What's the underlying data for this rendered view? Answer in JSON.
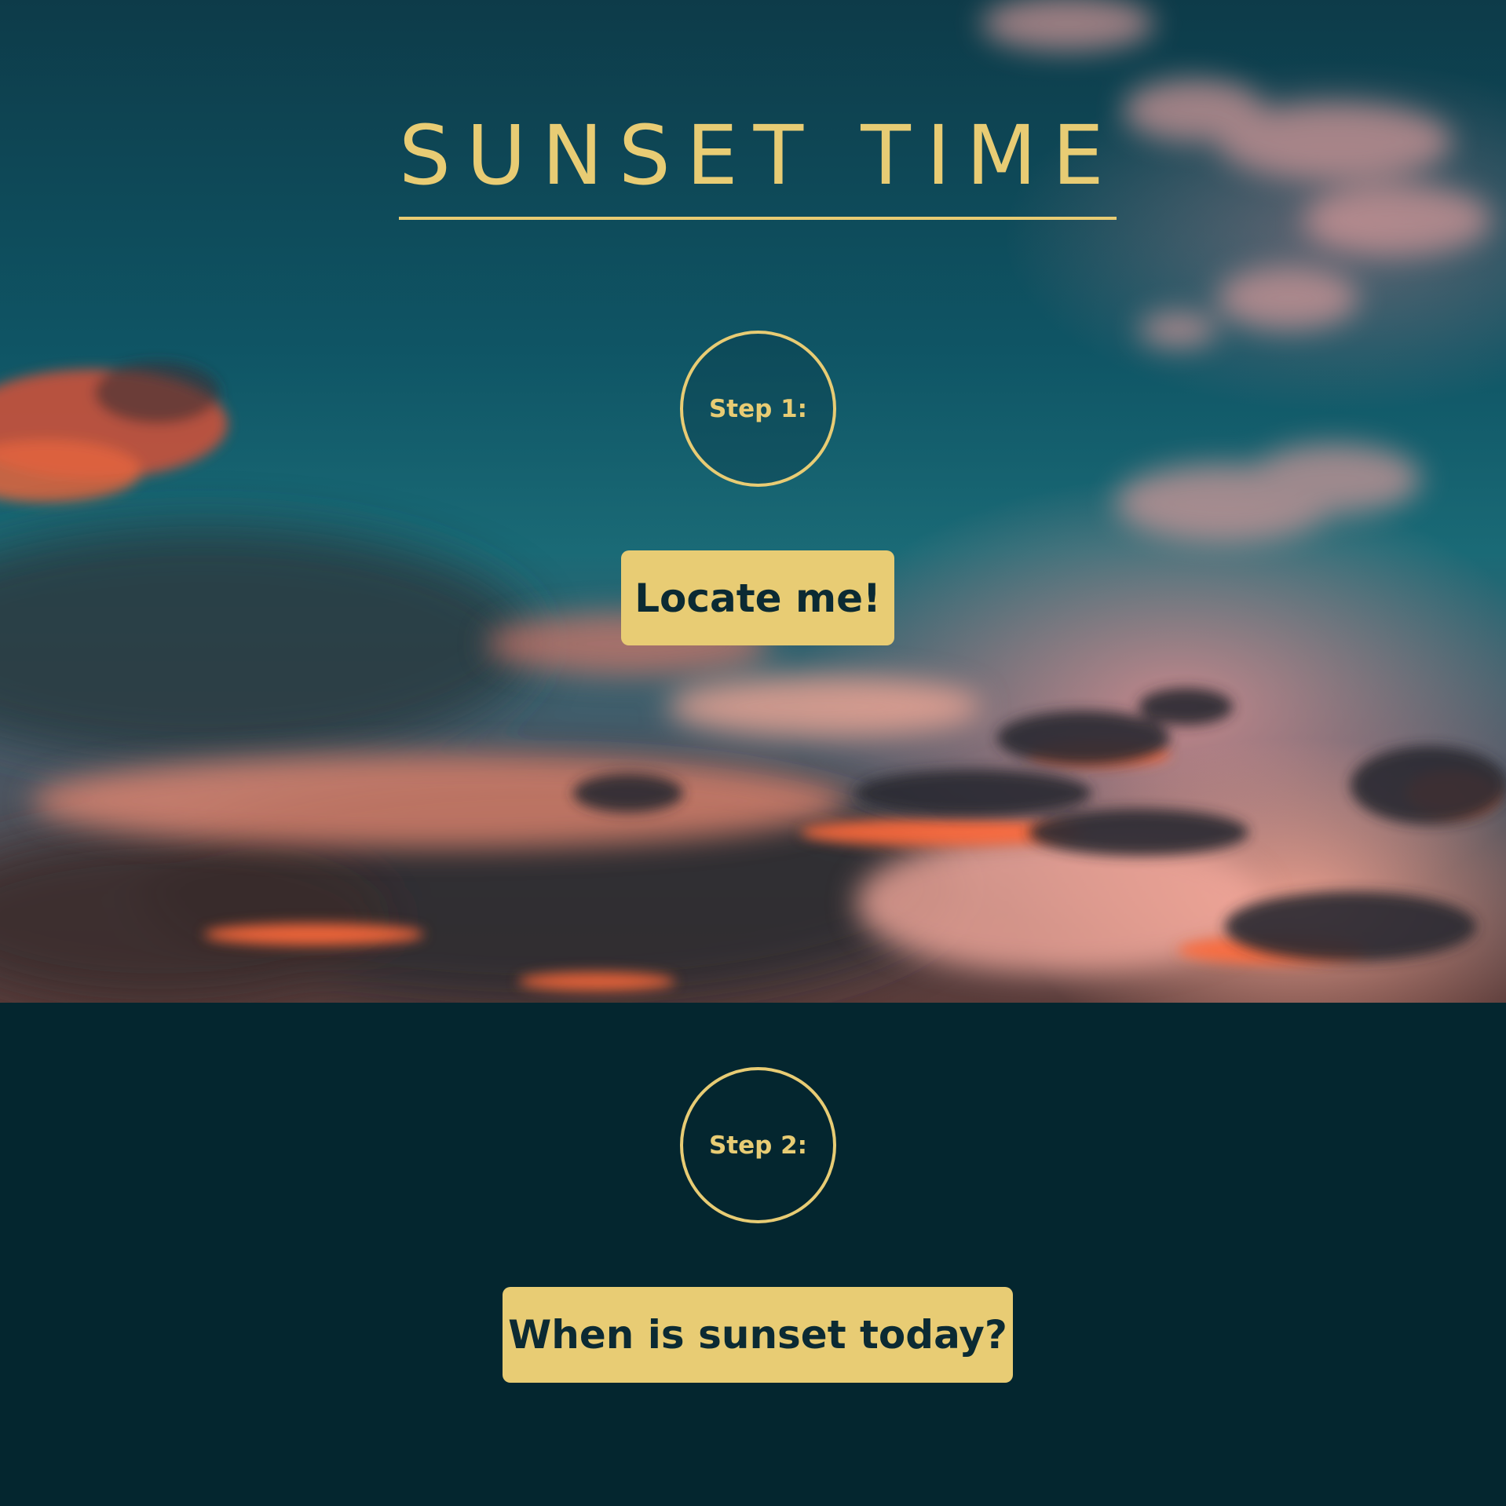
{
  "page": {
    "title": "SUNSET TIME"
  },
  "steps": [
    {
      "label": "Step 1:",
      "button_label": "Locate me!"
    },
    {
      "label": "Step 2:",
      "button_label": "When is sunset today?"
    }
  ],
  "colors": {
    "accent": "#e8cc74",
    "button_text": "#0b2a33",
    "lower_background": "#04262f",
    "sky_teal": "#0f5565",
    "cloud_orange": "#ff6a3a",
    "cloud_pink": "#f2a095"
  }
}
